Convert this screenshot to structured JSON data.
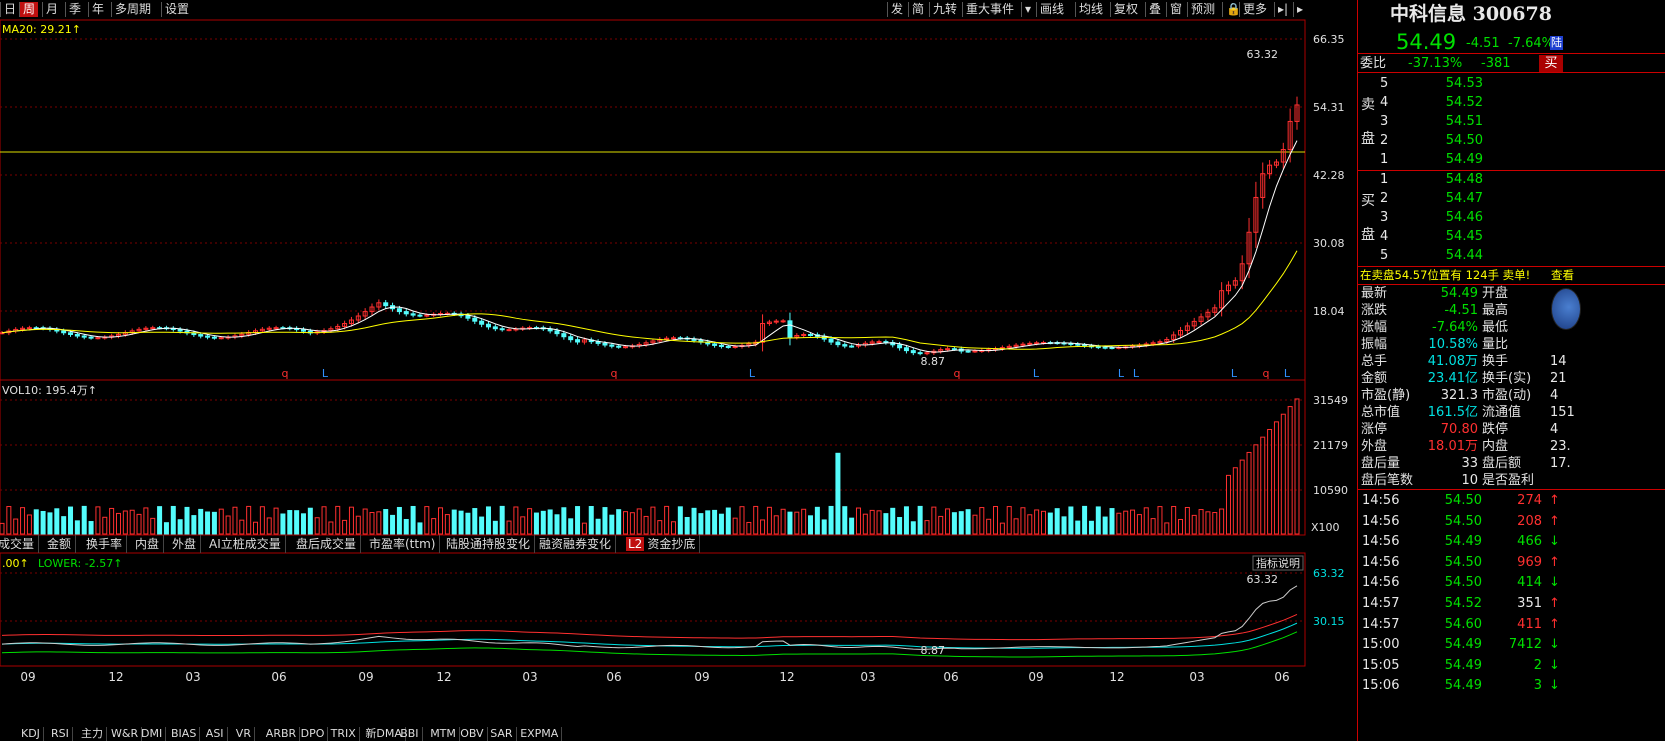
{
  "toolbar": {
    "left": [
      "日",
      "周",
      "月",
      "季",
      "年",
      "多周期",
      "设置"
    ],
    "active": "周",
    "right": [
      "发",
      "简",
      "九转",
      "重大事件",
      "▾",
      "画线",
      "均线",
      "复权",
      "叠",
      "窗",
      "预测",
      "🔒",
      "更多",
      "▸|",
      "▸"
    ]
  },
  "main_chart": {
    "ma_label": "MA20: 29.21↑",
    "axis_labels": [
      "66.35",
      "54.31",
      "42.28",
      "30.08",
      "18.04"
    ],
    "high_label": "63.32",
    "low_label": "8.87",
    "markers": [
      "q",
      "L",
      "q",
      "L",
      "q",
      "L",
      "L",
      "L",
      "L",
      "q",
      "L"
    ]
  },
  "volume_chart": {
    "label": "VOL10: 195.4万↑",
    "axis_labels": [
      "31549",
      "21179",
      "10590",
      "X100"
    ]
  },
  "indicator_tabs": [
    "成交量",
    "金额",
    "换手率",
    "内盘",
    "外盘",
    "AI立桩成交量",
    "盘后成交量",
    "市盈率(ttm)",
    "陆股通持股变化",
    "融资融券变化",
    "资金抄底"
  ],
  "indicator_l2": "L2",
  "lower_chart": {
    "label_prefix": ".00↑",
    "lower_label": "LOWER: -2.57↑",
    "button": "指标说明",
    "high_label": "63.32",
    "low_label": "8.87",
    "axis_labels": [
      "63.32",
      "30.15"
    ]
  },
  "x_axis": [
    "09",
    "12",
    "03",
    "06",
    "09",
    "12",
    "03",
    "06",
    "09",
    "12",
    "03",
    "06",
    "09",
    "12",
    "03",
    "06"
  ],
  "bottom_tabs": [
    "KDJ",
    "RSI",
    "主力",
    "W&R",
    "DMI",
    "BIAS",
    "ASI",
    "VR",
    "ARBR",
    "DPO",
    "TRIX",
    "新DMA",
    "BBI",
    "MTM",
    "OBV",
    "SAR",
    "EXPMA"
  ],
  "quote": {
    "name": "中科信息 300678",
    "price": "54.49",
    "change": "-4.51",
    "pct": "-7.64%",
    "badge": "陆",
    "weibi_label": "委比",
    "weibi": "-37.13%",
    "weicha": "-381",
    "buy_btn": "买",
    "sell_label": "卖盘",
    "buy_label": "买盘",
    "sells": [
      {
        "n": "5",
        "p": "54.53"
      },
      {
        "n": "4",
        "p": "54.52"
      },
      {
        "n": "3",
        "p": "54.51"
      },
      {
        "n": "2",
        "p": "54.50"
      },
      {
        "n": "1",
        "p": "54.49"
      }
    ],
    "buys": [
      {
        "n": "1",
        "p": "54.48"
      },
      {
        "n": "2",
        "p": "54.47"
      },
      {
        "n": "3",
        "p": "54.46"
      },
      {
        "n": "4",
        "p": "54.45"
      },
      {
        "n": "5",
        "p": "54.44"
      }
    ],
    "notice": "在卖盘54.57位置有 124手 卖单!",
    "notice_link": "查看",
    "stats": [
      {
        "l1": "最新",
        "v1": "54.49",
        "l2": "开盘",
        "v2": ""
      },
      {
        "l1": "涨跌",
        "v1": "-4.51",
        "l2": "最高",
        "v2": ""
      },
      {
        "l1": "涨幅",
        "v1": "-7.64%",
        "l2": "最低",
        "v2": ""
      },
      {
        "l1": "振幅",
        "v1": "10.58%",
        "l2": "量比",
        "v2": ""
      },
      {
        "l1": "总手",
        "v1": "41.08万",
        "l2": "换手",
        "v2": "14"
      },
      {
        "l1": "金额",
        "v1": "23.41亿",
        "l2": "换手(实)",
        "v2": "21"
      },
      {
        "l1": "市盈(静)",
        "v1": "321.3",
        "l2": "市盈(动)",
        "v2": "4"
      },
      {
        "l1": "总市值",
        "v1": "161.5亿",
        "l2": "流通值",
        "v2": "151"
      },
      {
        "l1": "涨停",
        "v1": "70.80",
        "l2": "跌停",
        "v2": "4"
      },
      {
        "l1": "外盘",
        "v1": "18.01万",
        "l2": "内盘",
        "v2": "23."
      },
      {
        "l1": "盘后量",
        "v1": "33",
        "l2": "盘后额",
        "v2": "17."
      },
      {
        "l1": "盘后笔数",
        "v1": "10",
        "l2": "是否盈利",
        "v2": ""
      }
    ],
    "ticks": [
      {
        "t": "14:56",
        "p": "54.50",
        "v": "274",
        "d": "up"
      },
      {
        "t": "14:56",
        "p": "54.50",
        "v": "208",
        "d": "up"
      },
      {
        "t": "14:56",
        "p": "54.49",
        "v": "466",
        "d": "down"
      },
      {
        "t": "14:56",
        "p": "54.50",
        "v": "969",
        "d": "up"
      },
      {
        "t": "14:56",
        "p": "54.50",
        "v": "414",
        "d": "down"
      },
      {
        "t": "14:57",
        "p": "54.52",
        "v": "351",
        "d": "up"
      },
      {
        "t": "14:57",
        "p": "54.60",
        "v": "411",
        "d": "up"
      },
      {
        "t": "15:00",
        "p": "54.49",
        "v": "7412",
        "d": "down"
      },
      {
        "t": "15:05",
        "p": "54.49",
        "v": "2",
        "d": "down"
      },
      {
        "t": "15:06",
        "p": "54.49",
        "v": "3",
        "d": "down"
      }
    ]
  },
  "colors": {
    "up": "#ff3030",
    "down": "#00e000",
    "bear_candle": "#54fcfc",
    "ma_white": "#ffffff",
    "ma_yellow": "#ffff00",
    "accent": "#c01010"
  }
}
